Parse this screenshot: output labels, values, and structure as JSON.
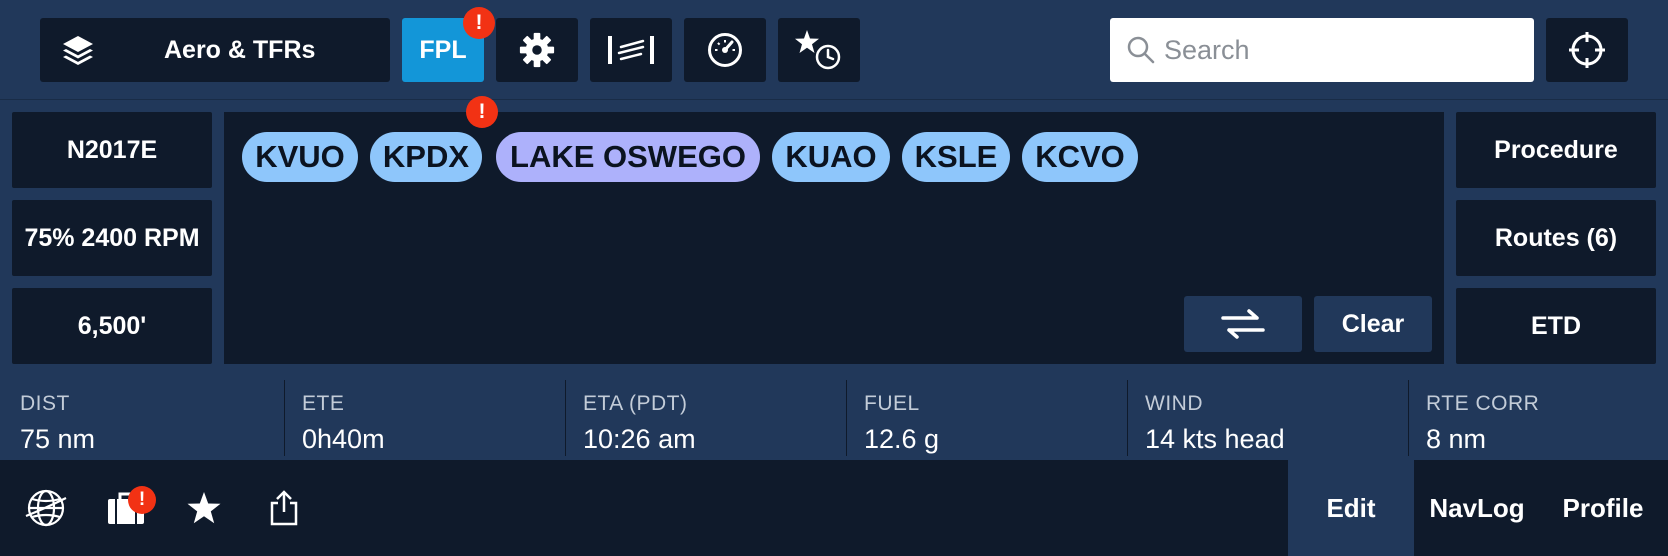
{
  "toolbar": {
    "layers_label": "Aero & TFRs",
    "fpl_label": "FPL",
    "fpl_alert": "!",
    "search_placeholder": "Search"
  },
  "left_column": {
    "aircraft": "N2017E",
    "power": "75% 2400 RPM",
    "altitude": "6,500'"
  },
  "route": {
    "waypoints": [
      {
        "label": "KVUO",
        "kind": "airport"
      },
      {
        "label": "KPDX",
        "kind": "airport",
        "alert": "!"
      },
      {
        "label": "LAKE OSWEGO",
        "kind": "user-waypoint"
      },
      {
        "label": "KUAO",
        "kind": "airport"
      },
      {
        "label": "KSLE",
        "kind": "airport"
      },
      {
        "label": "KCVO",
        "kind": "airport"
      }
    ],
    "clear_label": "Clear"
  },
  "right_column": {
    "procedure": "Procedure",
    "routes": "Routes (6)",
    "etd": "ETD"
  },
  "stats": [
    {
      "label": "DIST",
      "value": "75 nm"
    },
    {
      "label": "ETE",
      "value": "0h40m"
    },
    {
      "label": "ETA (PDT)",
      "value": "10:26 am"
    },
    {
      "label": "FUEL",
      "value": "12.6 g"
    },
    {
      "label": "WIND",
      "value": "14 kts head"
    },
    {
      "label": "RTE CORR",
      "value": "8 nm"
    }
  ],
  "bottom": {
    "briefcase_alert": "!",
    "tabs": [
      {
        "label": "Edit",
        "active": true
      },
      {
        "label": "NavLog",
        "active": false
      },
      {
        "label": "Profile",
        "active": false
      }
    ]
  },
  "colors": {
    "background": "#21385a",
    "panel": "#0f1a2b",
    "accent": "#1396d8",
    "alert": "#f23214",
    "airport_chip": "#8ec6fb",
    "waypoint_chip": "#adb1fb"
  },
  "icons": [
    "layers-icon",
    "gear-icon",
    "wind-icon",
    "gauge-icon",
    "recent-favorites-icon",
    "search-icon",
    "locate-icon",
    "swap-icon",
    "globe-icon",
    "briefcase-icon",
    "star-icon",
    "share-icon"
  ]
}
